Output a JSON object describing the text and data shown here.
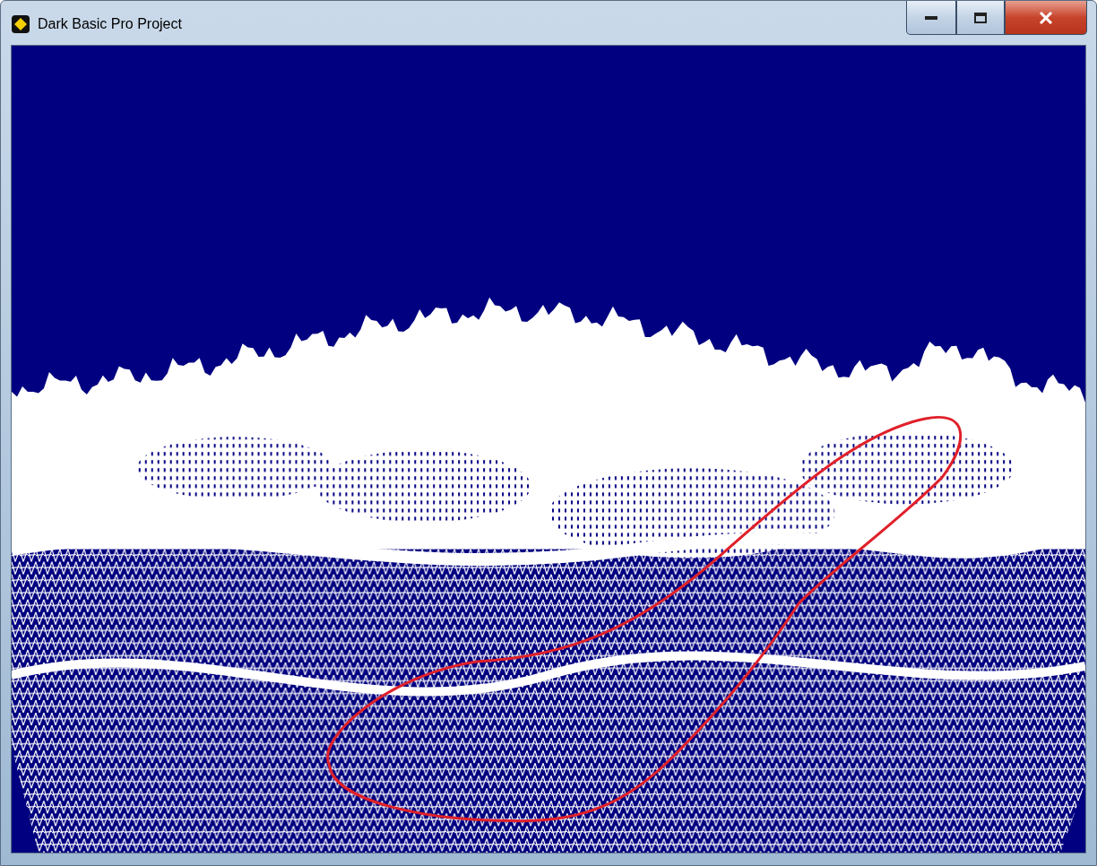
{
  "window": {
    "title": "Dark Basic Pro Project"
  }
}
